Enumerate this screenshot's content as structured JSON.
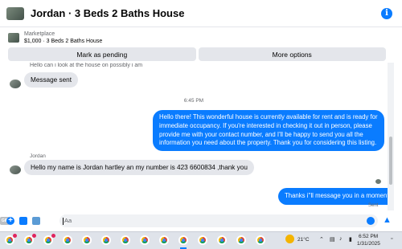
{
  "header": {
    "title": "Jordan · 3 Beds 2 Baths House",
    "info_icon": "i"
  },
  "listing": {
    "source": "Marketplace",
    "detail": "$1,000 · 3 Beds 2 Baths House"
  },
  "actions": {
    "mark_pending": "Mark as pending",
    "more_options": "More options"
  },
  "conversation": {
    "cut_off_text": "Hello can i look at the house on possibly i am",
    "msg_sent": "Message sent",
    "timestamp": "6:45 PM",
    "outgoing_1": "Hello there! This wonderful house is currently available for rent and is ready for immediate occupancy. If you're interested in checking it out in person, please provide me with your contact number, and I'll be happy to send you all the information you need about the property. Thank you for considering this listing.",
    "sender_name": "Jordan",
    "incoming_2": "Hello my name is Jordan hartley an my number is 423 6600834 ,thank you",
    "outgoing_2": "Thanks i''ll message you in a moment",
    "status": "Sent"
  },
  "composer": {
    "placeholder": "Aa",
    "gif_label": "GIF"
  },
  "taskbar": {
    "temperature": "21°C",
    "time": "6:52 PM",
    "date": "1/31/2025",
    "colors": {
      "accent": "#0a7cff",
      "badge": "#e0245e"
    }
  }
}
